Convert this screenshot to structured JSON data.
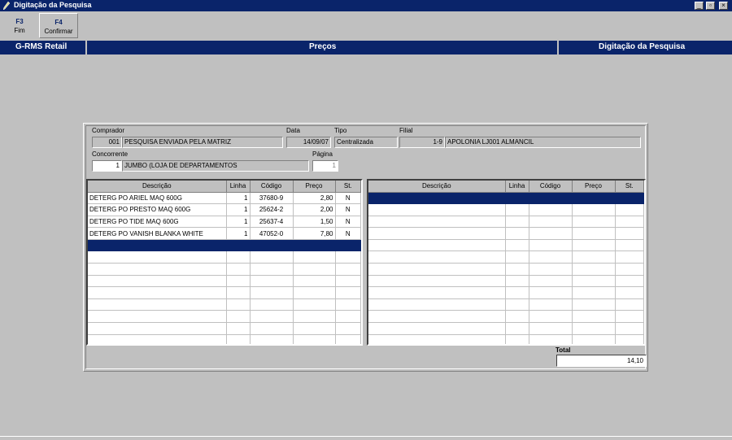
{
  "window": {
    "title": "Digitação da Pesquisa",
    "minimize": "_",
    "restore": "▫",
    "close": "×"
  },
  "toolbar": [
    {
      "key": "F3",
      "label": "Fim"
    },
    {
      "key": "F4",
      "label": "Confirmar"
    }
  ],
  "header": {
    "app": "G-RMS Retail",
    "module": "Preços",
    "screen": "Digitação da Pesquisa"
  },
  "form": {
    "comprador_label": "Comprador",
    "comprador_code": "001",
    "comprador_name": "PESQUISA ENVIADA PELA MATRIZ",
    "data_label": "Data",
    "data_value": "14/09/07",
    "tipo_label": "Tipo",
    "tipo_value": "Centralizada",
    "filial_label": "Filial",
    "filial_code": "1-9",
    "filial_name": "APOLONIA LJ001 ALMANCIL",
    "concorrente_label": "Concorrente",
    "concorrente_code": "1",
    "concorrente_name": "JUMBO (LOJA DE DEPARTAMENTOS",
    "pagina_label": "Página",
    "pagina_value": "1"
  },
  "grid_columns": [
    "Descrição",
    "Linha",
    "Código",
    "Preço",
    "St."
  ],
  "left_rows": [
    {
      "descricao": "DETERG PO ARIEL MAQ 600G",
      "linha": "1",
      "codigo": "37680-9",
      "preco": "2,80",
      "st": "N"
    },
    {
      "descricao": "DETERG PO PRESTO MAQ 600G",
      "linha": "1",
      "codigo": "25624-2",
      "preco": "2,00",
      "st": "N"
    },
    {
      "descricao": "DETERG PO TIDE MAQ 600G",
      "linha": "1",
      "codigo": "25637-4",
      "preco": "1,50",
      "st": "N"
    },
    {
      "descricao": "DETERG PO VANISH BLANKA WHITE",
      "linha": "1",
      "codigo": "47052-0",
      "preco": "7,80",
      "st": "N"
    }
  ],
  "total": {
    "label": "Total",
    "value": "14,10"
  },
  "colors": {
    "navy": "#0a246a",
    "face": "#c0c0c0"
  }
}
